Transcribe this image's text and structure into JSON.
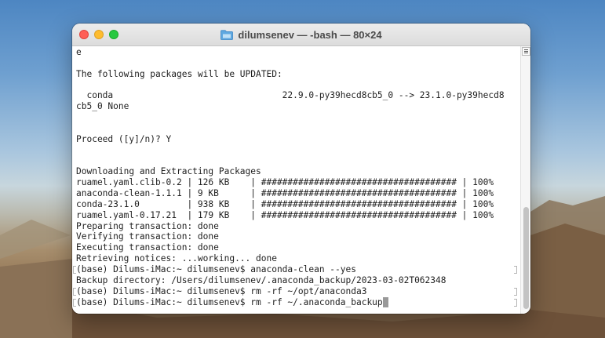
{
  "window": {
    "title": "dilumsenev — -bash — 80×24"
  },
  "terminal": {
    "lines": [
      {
        "text": "e",
        "mark": false
      },
      {
        "text": "",
        "mark": false
      },
      {
        "text": "The following packages will be UPDATED:",
        "mark": false
      },
      {
        "text": "",
        "mark": false
      },
      {
        "text": "  conda                                22.9.0-py39hecd8cb5_0 --> 23.1.0-py39hecd8",
        "mark": false
      },
      {
        "text": "cb5_0 None",
        "mark": false
      },
      {
        "text": "",
        "mark": false
      },
      {
        "text": "",
        "mark": false
      },
      {
        "text": "Proceed ([y]/n)? Y",
        "mark": false
      },
      {
        "text": "",
        "mark": false
      },
      {
        "text": "",
        "mark": false
      },
      {
        "text": "Downloading and Extracting Packages",
        "mark": false
      },
      {
        "text": "ruamel.yaml.clib-0.2 | 126 KB    | ##################################### | 100%",
        "mark": false
      },
      {
        "text": "anaconda-clean-1.1.1 | 9 KB      | ##################################### | 100%",
        "mark": false
      },
      {
        "text": "conda-23.1.0         | 938 KB    | ##################################### | 100%",
        "mark": false
      },
      {
        "text": "ruamel.yaml-0.17.21  | 179 KB    | ##################################### | 100%",
        "mark": false
      },
      {
        "text": "Preparing transaction: done",
        "mark": false
      },
      {
        "text": "Verifying transaction: done",
        "mark": false
      },
      {
        "text": "Executing transaction: done",
        "mark": false
      },
      {
        "text": "Retrieving notices: ...working... done",
        "mark": false
      },
      {
        "text": "(base) Dilums-iMac:~ dilumsenev$ anaconda-clean --yes",
        "mark": true
      },
      {
        "text": "Backup directory: /Users/dilumsenev/.anaconda_backup/2023-03-02T062348",
        "mark": false
      },
      {
        "text": "(base) Dilums-iMac:~ dilumsenev$ rm -rf ~/opt/anaconda3",
        "mark": true
      },
      {
        "text": "(base) Dilums-iMac:~ dilumsenev$ rm -rf ~/.anaconda_backup",
        "mark": true,
        "cursor": true
      }
    ]
  },
  "icons": {
    "folder": "folder-icon",
    "scroll_menu": "list-icon"
  }
}
